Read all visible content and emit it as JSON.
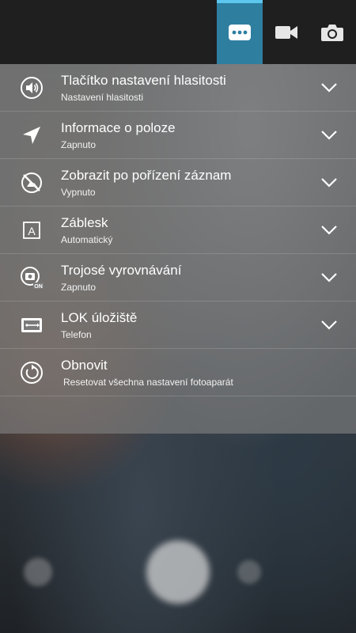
{
  "top_bar": {
    "buttons": [
      {
        "name": "more-options",
        "icon": "dots-icon",
        "active": true
      },
      {
        "name": "video-mode",
        "icon": "video-camera-icon",
        "active": false
      },
      {
        "name": "photo-mode",
        "icon": "camera-icon",
        "active": false
      }
    ]
  },
  "settings": [
    {
      "title": "Tlačítko nastavení hlasitosti",
      "subtitle": "Nastavení hlasitosti",
      "icon": "volume-icon",
      "expandable": true
    },
    {
      "title": "Informace o poloze",
      "subtitle": "Zapnuto",
      "icon": "location-icon",
      "expandable": true
    },
    {
      "title": "Zobrazit po pořízení záznamu",
      "subtitle": "Vypnuto",
      "icon": "no-preview-icon",
      "expandable": true
    },
    {
      "title": "Záblesk",
      "subtitle": "Automatický",
      "icon": "flash-auto-icon",
      "expandable": true
    },
    {
      "title": "Trojosé vyrovnávání",
      "subtitle": "Zapnuto",
      "icon": "stabilization-icon",
      "expandable": true
    },
    {
      "title": "LOK úložiště",
      "subtitle": "Telefon",
      "icon": "storage-icon",
      "expandable": true
    },
    {
      "title": "Obnovit",
      "subtitle": "Resetovat všechna nastavení fotoaparátu",
      "icon": "reset-icon",
      "expandable": false
    }
  ],
  "colors": {
    "accent": "#2e7ea0",
    "accent_line": "#5cc6ee",
    "top_bar": "#1f1f1f"
  }
}
